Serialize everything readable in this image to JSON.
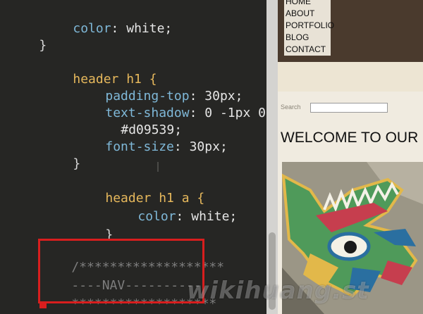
{
  "editor": {
    "lines": [
      {
        "prop": "color",
        "val": "white;"
      },
      {
        "brace": "}"
      },
      {
        "selector": "header h1 {"
      },
      {
        "prop": "padding-top",
        "val": "30px;"
      },
      {
        "prop": "text-shadow",
        "val": "0 -1px 0"
      },
      {
        "val": "#d09539;"
      },
      {
        "prop": "font-size",
        "val": "30px;"
      },
      {
        "brace": "}"
      },
      {
        "selector": "header h1 a {"
      },
      {
        "prop": "color",
        "val": "white;"
      },
      {
        "brace": "}"
      },
      {
        "comment": "/*******************"
      },
      {
        "comment": "----NAV----------"
      },
      {
        "comment": "*******************"
      }
    ],
    "colon": ":",
    "highlight_color": "#d81e1e"
  },
  "preview": {
    "nav_items": [
      "HOME",
      "ABOUT",
      "PORTFOLIO",
      "BLOG",
      "CONTACT"
    ],
    "search_label": "Search",
    "search_value": "",
    "welcome_heading": "WELCOME TO OUR S",
    "header_color": "#4a3a2d",
    "image_alt": "dragon artwork"
  },
  "watermark": "wikihuang.st"
}
